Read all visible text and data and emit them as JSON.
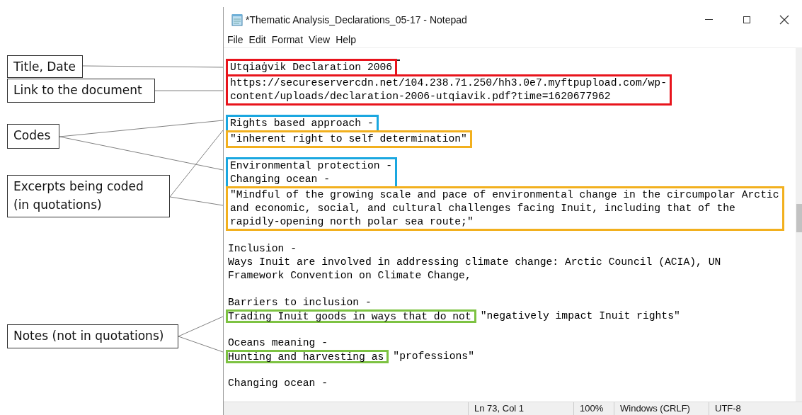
{
  "callouts": [
    {
      "label": "Title, Date"
    },
    {
      "label": "Link to the document"
    },
    {
      "label": "Codes"
    },
    {
      "label": "Excerpts being coded (in quotations)"
    },
    {
      "label": "Notes (not in quotations)"
    }
  ],
  "window": {
    "title": "*Thematic Analysis_Declarations_05-17 - Notepad"
  },
  "menu": [
    "File",
    "Edit",
    "Format",
    "View",
    "Help"
  ],
  "editor": {
    "blocks": [
      {
        "kind": "boxed",
        "color": "#e8141c",
        "lines": [
          "Utqiaġvik Declaration 2006"
        ]
      },
      {
        "kind": "boxed",
        "color": "#e8141c",
        "lines": [
          "https://secureservercdn.net/104.238.71.250/hh3.0e7.myftpupload.com/wp-",
          "content/uploads/declaration-2006-utqiavik.pdf?time=1620677962"
        ]
      },
      {
        "kind": "blank"
      },
      {
        "kind": "boxed",
        "color": "#1aa7e0",
        "lines": [
          "Rights based approach -"
        ]
      },
      {
        "kind": "boxed",
        "color": "#f2b01e",
        "lines": [
          "\"inherent right to self determination\""
        ]
      },
      {
        "kind": "blank"
      },
      {
        "kind": "boxed",
        "color": "#1aa7e0",
        "lines": [
          "Environmental protection -",
          "Changing ocean -"
        ]
      },
      {
        "kind": "boxed",
        "color": "#f2b01e",
        "lines": [
          "\"Mindful of the growing scale and pace of environmental change in the circumpolar Arctic",
          "and economic, social, and cultural challenges facing Inuit, including that of the",
          "rapidly-opening north polar sea route;\""
        ]
      },
      {
        "kind": "blank"
      },
      {
        "kind": "text",
        "lines": [
          "Inclusion -",
          "Ways Inuit are involved in addressing climate change: Arctic Council (ACIA), UN",
          "Framework Convention on Climate Change,"
        ]
      },
      {
        "kind": "blank"
      },
      {
        "kind": "text",
        "lines": [
          "Barriers to inclusion -"
        ]
      },
      {
        "kind": "mixed",
        "color": "#7dc242",
        "boxed": "Trading Inuit goods in ways that do not",
        "rest": "\"negatively impact Inuit rights\""
      },
      {
        "kind": "blank"
      },
      {
        "kind": "text",
        "lines": [
          "Oceans meaning -"
        ]
      },
      {
        "kind": "mixed",
        "color": "#7dc242",
        "boxed": "Hunting and harvesting as",
        "rest": "\"professions\""
      },
      {
        "kind": "blank"
      },
      {
        "kind": "text",
        "lines": [
          "Changing ocean -"
        ]
      }
    ]
  },
  "status_bar": [
    "Ln 73, Col 1",
    "100%",
    "Windows (CRLF)",
    "UTF-8"
  ]
}
